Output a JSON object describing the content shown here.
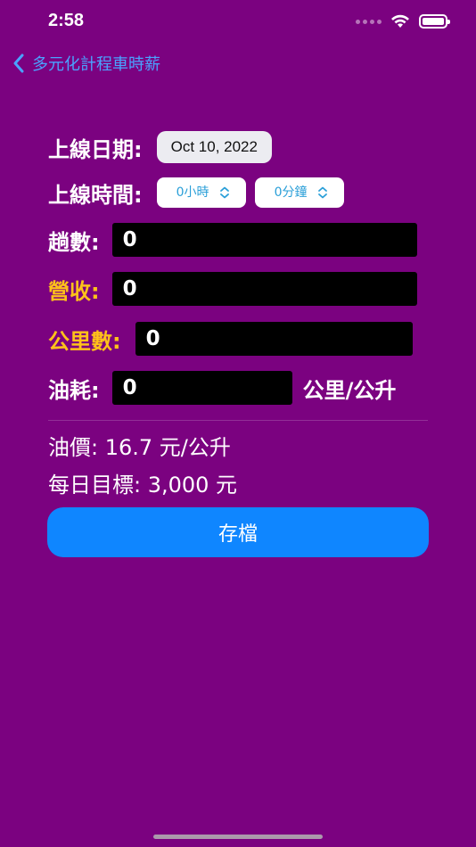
{
  "status_bar": {
    "time": "2:58"
  },
  "nav": {
    "back_title": "多元化計程車時薪"
  },
  "form": {
    "date_label": "上線日期:",
    "date_value": "Oct 10, 2022",
    "time_label": "上線時間:",
    "hours_picker": "0小時",
    "minutes_picker": "0分鐘",
    "trips_label": "趟數:",
    "trips_value": "0",
    "revenue_label": "營收:",
    "revenue_value": "0",
    "distance_label": "公里數:",
    "distance_value": "0",
    "fuel_label": "油耗:",
    "fuel_value": "0",
    "fuel_unit": "公里/公升"
  },
  "info": {
    "fuel_price": "油價: 16.7 元/公升",
    "daily_goal": "每日目標: 3,000 元"
  },
  "actions": {
    "save_label": "存檔"
  },
  "colors": {
    "background": "#7b0280",
    "accent": "#0f86ff",
    "highlight_label": "#ffc21a",
    "link": "#4aa3ff"
  }
}
